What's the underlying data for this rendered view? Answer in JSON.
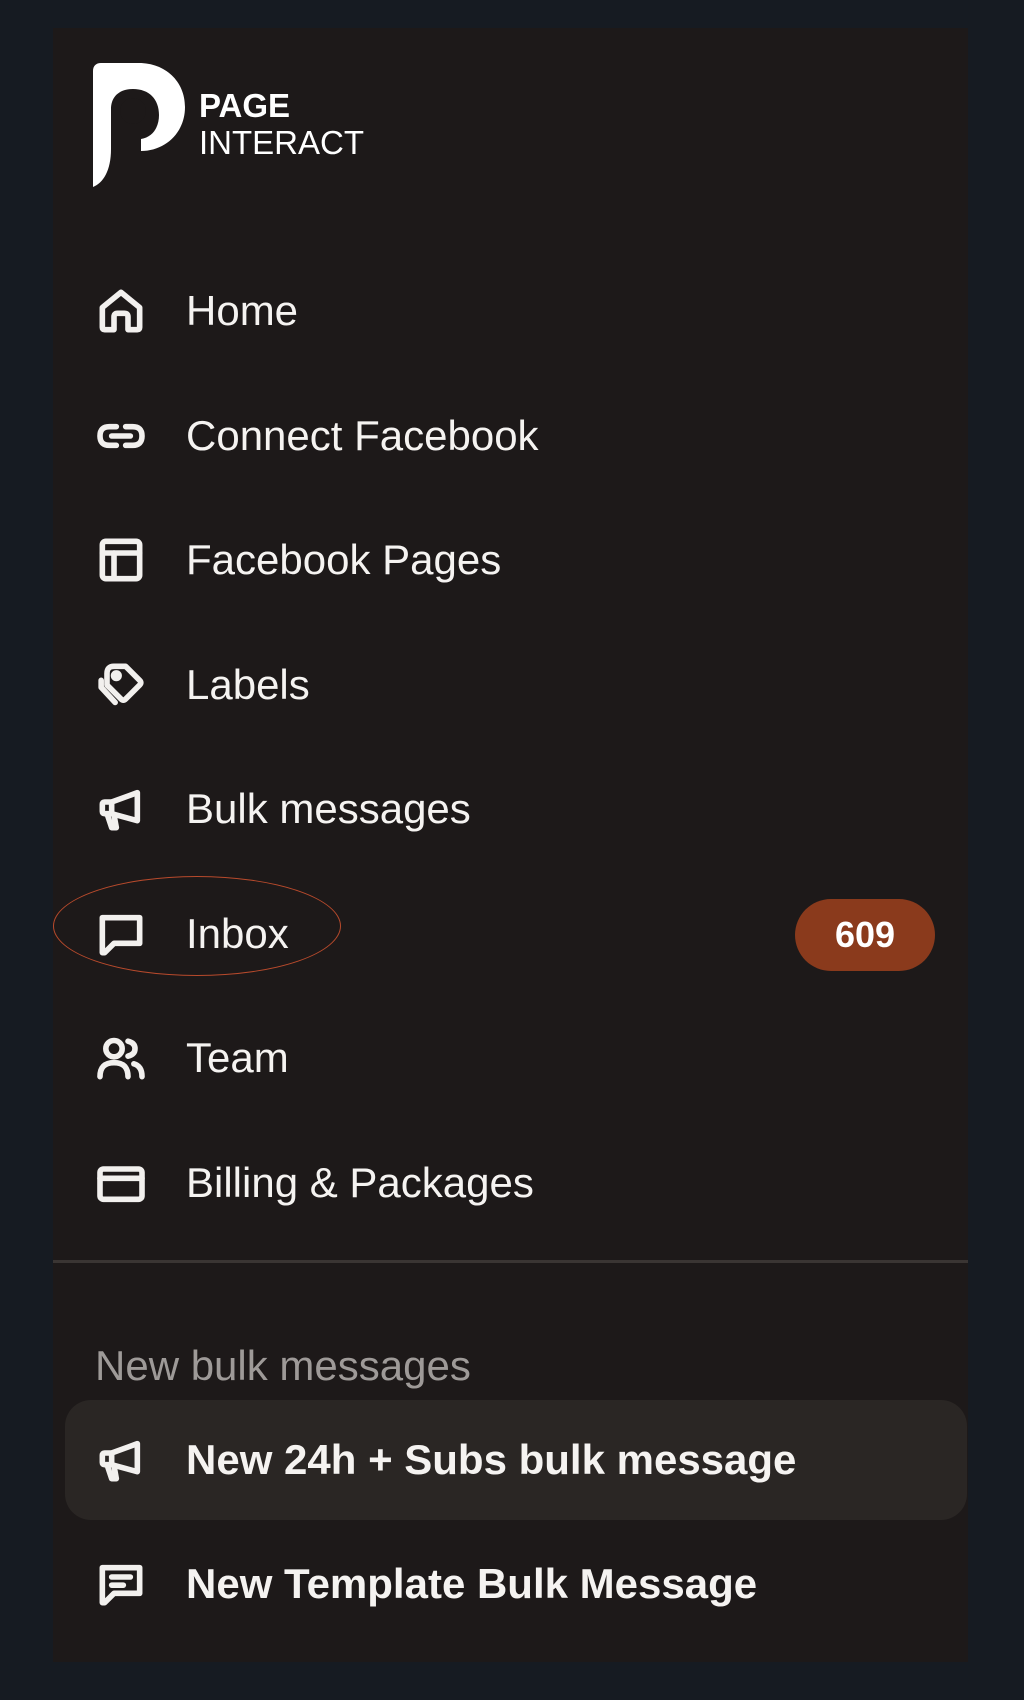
{
  "brand": {
    "line1": "PAGE",
    "line2": "INTERACT"
  },
  "nav": {
    "items": [
      {
        "label": "Home",
        "icon": "home-icon"
      },
      {
        "label": "Connect Facebook",
        "icon": "link-icon"
      },
      {
        "label": "Facebook Pages",
        "icon": "layout-icon"
      },
      {
        "label": "Labels",
        "icon": "tags-icon"
      },
      {
        "label": "Bulk messages",
        "icon": "megaphone-icon"
      },
      {
        "label": "Inbox",
        "icon": "message-square-icon",
        "badge": "609"
      },
      {
        "label": "Team",
        "icon": "users-icon"
      },
      {
        "label": "Billing & Packages",
        "icon": "credit-card-icon"
      }
    ]
  },
  "section": {
    "heading": "New bulk messages",
    "items": [
      {
        "label": "New 24h + Subs bulk message",
        "icon": "megaphone-icon",
        "active": true
      },
      {
        "label": "New Template Bulk Message",
        "icon": "message-text-icon",
        "active": false
      }
    ]
  },
  "colors": {
    "background": "#161b22",
    "sidebar": "#1d1919",
    "badge": "#8a3a1c",
    "highlight_ring": "#b84a2c",
    "active_item": "#2a2624"
  }
}
